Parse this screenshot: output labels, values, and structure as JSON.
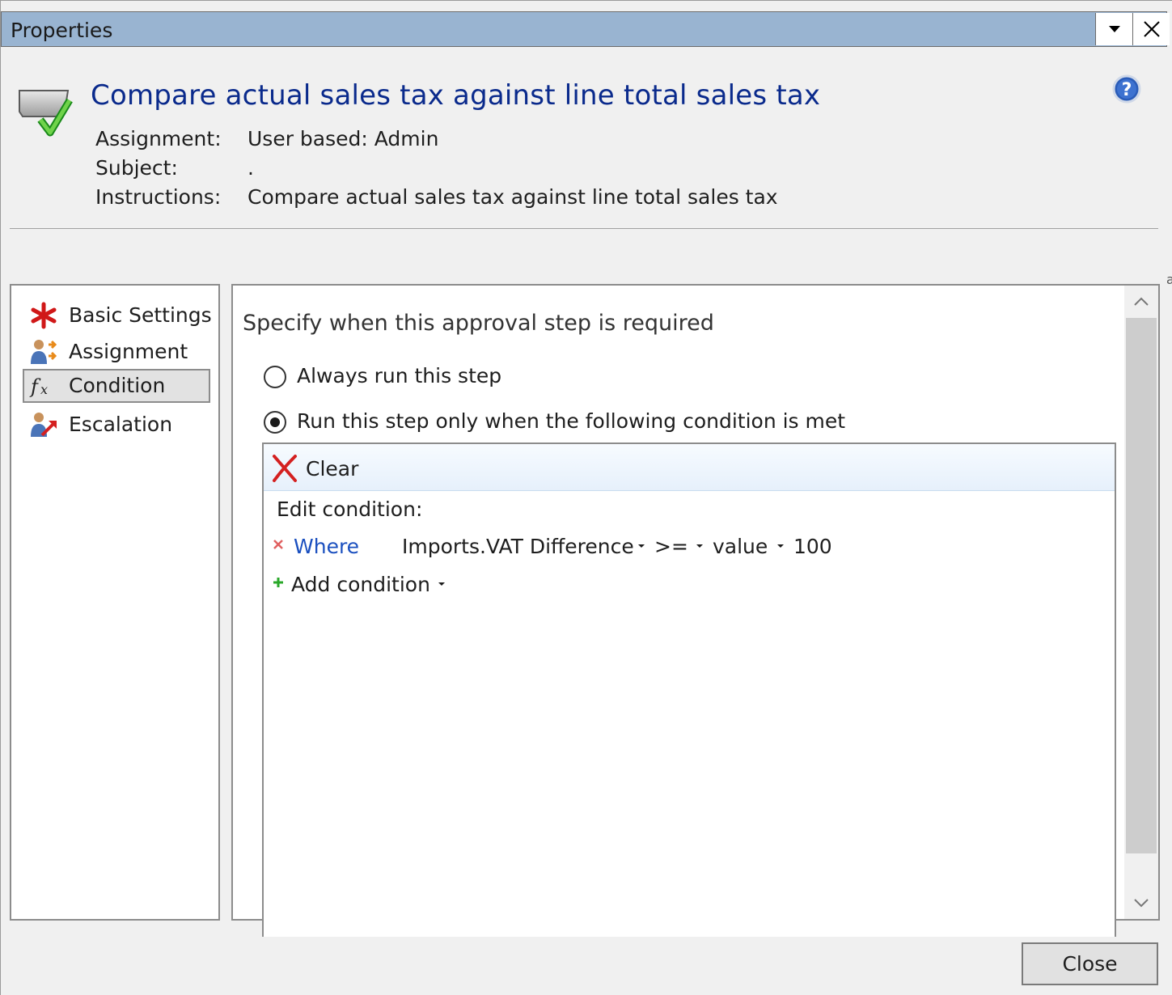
{
  "window": {
    "title": "Properties",
    "dropdown_icon": "chevron-down-icon",
    "close_icon": "close-icon"
  },
  "header": {
    "title": "Compare actual sales tax against line total sales tax",
    "icon": "approval-step-icon",
    "help_icon": "help-icon",
    "fields": [
      {
        "label": "Assignment:",
        "value": "User based: Admin"
      },
      {
        "label": "Subject:",
        "value": "."
      },
      {
        "label": "Instructions:",
        "value": "Compare actual sales tax against line total sales tax"
      }
    ]
  },
  "nav": {
    "items": [
      {
        "label": "Basic Settings",
        "icon": "asterisk-icon",
        "selected": false
      },
      {
        "label": "Assignment",
        "icon": "user-assign-icon",
        "selected": false
      },
      {
        "label": "Condition",
        "icon": "function-icon",
        "selected": true
      },
      {
        "label": "Escalation",
        "icon": "user-escalate-icon",
        "selected": false
      }
    ]
  },
  "panel": {
    "heading": "Specify when this approval step is required",
    "options": [
      {
        "label": "Always run this step",
        "checked": false
      },
      {
        "label": "Run this step only when the following condition is met",
        "checked": true
      }
    ],
    "condition_editor": {
      "clear_label": "Clear",
      "edit_label": "Edit condition:",
      "condition": {
        "where_label": "Where",
        "field": "Imports.VAT Difference",
        "operator": ">=",
        "value_type": "value",
        "value": "100"
      },
      "add_condition_label": "Add condition"
    }
  },
  "footer": {
    "close_label": "Close"
  },
  "colors": {
    "titlebar": "#99b4d1",
    "header_title": "#0a2a8c",
    "link": "#1a4fbf"
  }
}
